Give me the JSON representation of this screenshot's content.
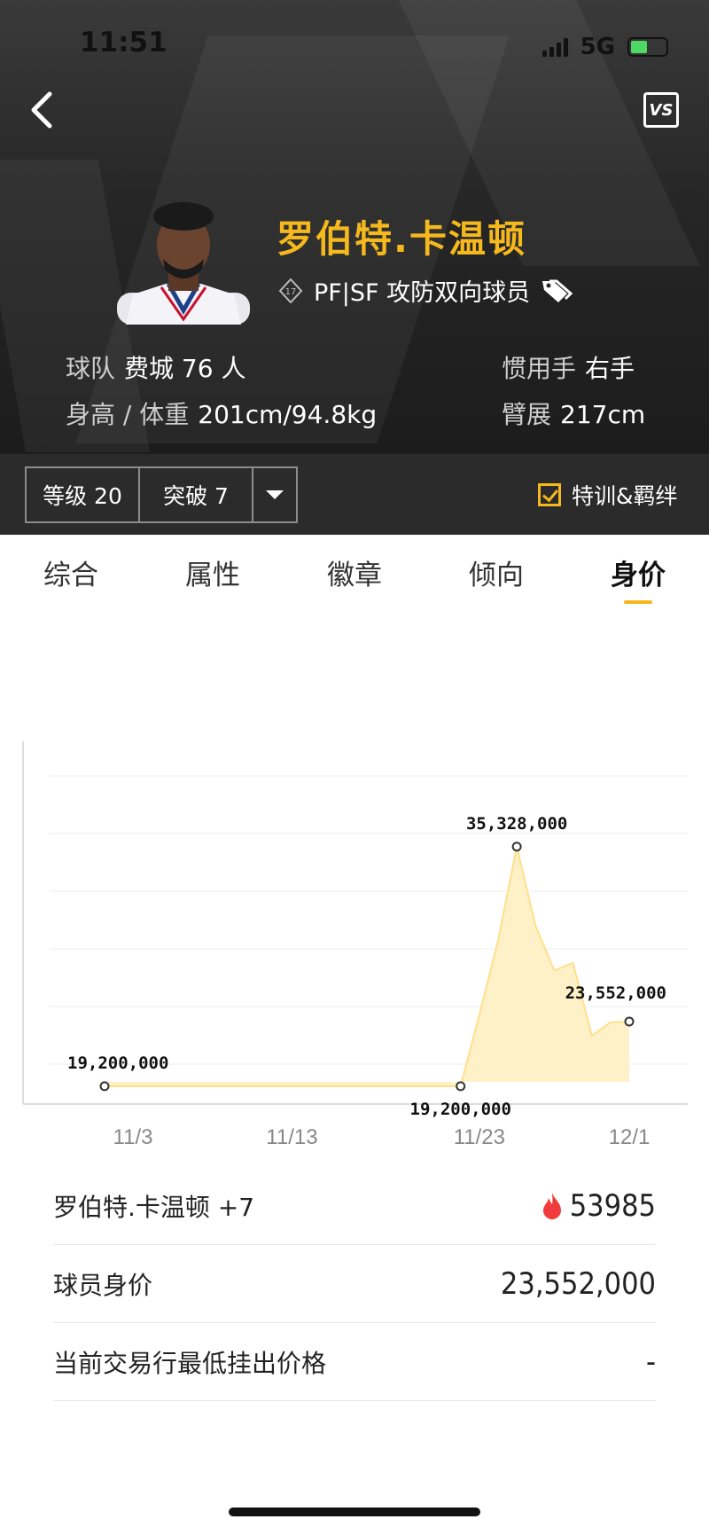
{
  "status": {
    "time": "11:51",
    "network": "5G"
  },
  "player": {
    "name": "罗伯特.卡温顿",
    "role": "PF|SF 攻防双向球员",
    "team_key": "球队",
    "team": "费城 76 人",
    "hand_key": "惯用手",
    "hand": "右手",
    "hw_key": "身高 / 体重",
    "hw": "201cm/94.8kg",
    "wingspan_key": "臂展",
    "wingspan": "217cm"
  },
  "toolbar": {
    "level": "等级 20",
    "breakthrough": "突破 7",
    "training": "特训&羁绊",
    "training_checked": true
  },
  "tabs": [
    {
      "label": "综合",
      "active": false
    },
    {
      "label": "属性",
      "active": false
    },
    {
      "label": "徽章",
      "active": false
    },
    {
      "label": "倾向",
      "active": false
    },
    {
      "label": "身价",
      "active": true
    }
  ],
  "chart_data": {
    "type": "area",
    "x": [
      "11/3",
      "11/5",
      "11/7",
      "11/9",
      "11/11",
      "11/13",
      "11/15",
      "11/17",
      "11/19",
      "11/21",
      "11/22",
      "11/23",
      "11/24",
      "11/25",
      "11/26",
      "11/27",
      "11/28",
      "11/29",
      "11/30",
      "12/1"
    ],
    "values": [
      19200000,
      19200000,
      19200000,
      19200000,
      19200000,
      19200000,
      19200000,
      19200000,
      19200000,
      19200000,
      19200000,
      24000000,
      29000000,
      35328000,
      30000000,
      27000000,
      27500000,
      22600000,
      23500000,
      23552000
    ],
    "xticks": [
      "11/3",
      "11/13",
      "11/23",
      "12/1"
    ],
    "annotations": [
      {
        "x": "11/3",
        "label": "19,200,000"
      },
      {
        "x": "11/22",
        "label": "19,200,000"
      },
      {
        "x": "11/25",
        "label": "35,328,000"
      },
      {
        "x": "12/1",
        "label": "23,552,000"
      }
    ],
    "ylim": [
      18000000,
      38000000
    ],
    "grid": true,
    "colors": {
      "fill": "#fff1c7",
      "line": "#ffe08a",
      "marker": "#333333"
    }
  },
  "details": {
    "card_name": "罗伯特.卡温顿 +7",
    "hot_count": "53985",
    "value_label": "球员身价",
    "value": "23,552,000",
    "market_label": "当前交易行最低挂出价格",
    "market_value": "-"
  }
}
